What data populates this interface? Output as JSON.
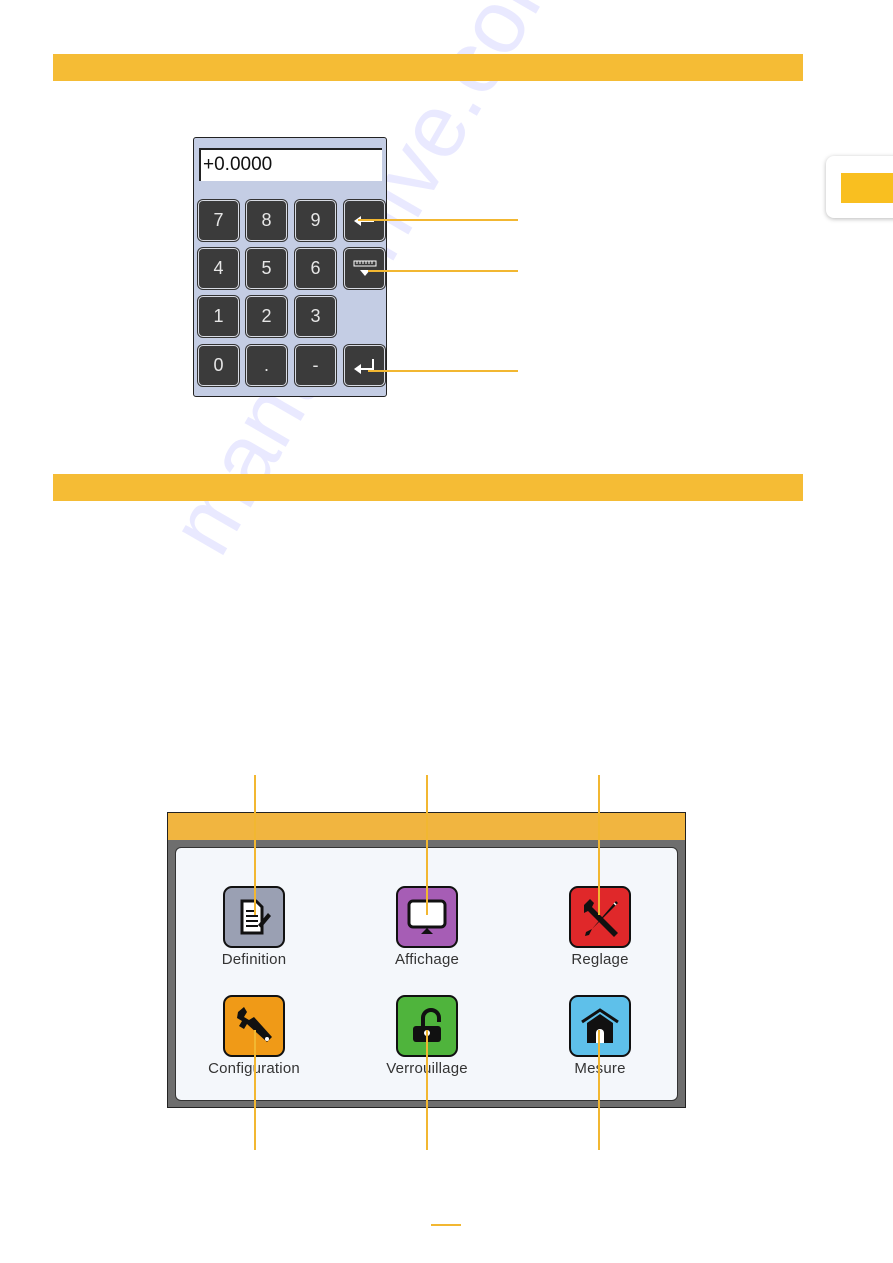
{
  "sections": [
    {
      "name": "keypad-section"
    },
    {
      "name": "menu-section"
    }
  ],
  "keypad": {
    "display_value": "+0.0000",
    "keys": [
      {
        "label": "7",
        "role": "digit"
      },
      {
        "label": "8",
        "role": "digit"
      },
      {
        "label": "9",
        "role": "digit"
      },
      {
        "label": "",
        "role": "backspace",
        "icon": "arrow-left-icon"
      },
      {
        "label": "4",
        "role": "digit"
      },
      {
        "label": "5",
        "role": "digit"
      },
      {
        "label": "6",
        "role": "digit"
      },
      {
        "label": "",
        "role": "acquire-measure",
        "icon": "ruler-down-icon"
      },
      {
        "label": "1",
        "role": "digit"
      },
      {
        "label": "2",
        "role": "digit"
      },
      {
        "label": "3",
        "role": "digit"
      },
      {
        "label": "0",
        "role": "digit"
      },
      {
        "label": ".",
        "role": "decimal"
      },
      {
        "label": "-",
        "role": "sign"
      },
      {
        "label": "",
        "role": "enter",
        "icon": "enter-icon"
      }
    ]
  },
  "menu": {
    "items": [
      {
        "label": "Definition",
        "icon": "document-edit-icon",
        "color": "#9aa0b3"
      },
      {
        "label": "Affichage",
        "icon": "monitor-icon",
        "color": "#a65db5"
      },
      {
        "label": "Reglage",
        "icon": "tools-icon",
        "color": "#e0282a"
      },
      {
        "label": "Configuration",
        "icon": "wrench-icon",
        "color": "#f09a17"
      },
      {
        "label": "Verrouillage",
        "icon": "unlock-icon",
        "color": "#4fb43c"
      },
      {
        "label": "Mesure",
        "icon": "home-icon",
        "color": "#5ec0ea"
      }
    ]
  },
  "colors": {
    "accent": "#f5bc35",
    "keypad_bg": "#c4cde4",
    "key_bg": "#3b3b3b",
    "menu_title": "#f1b540"
  },
  "watermark": "manualshive.com"
}
